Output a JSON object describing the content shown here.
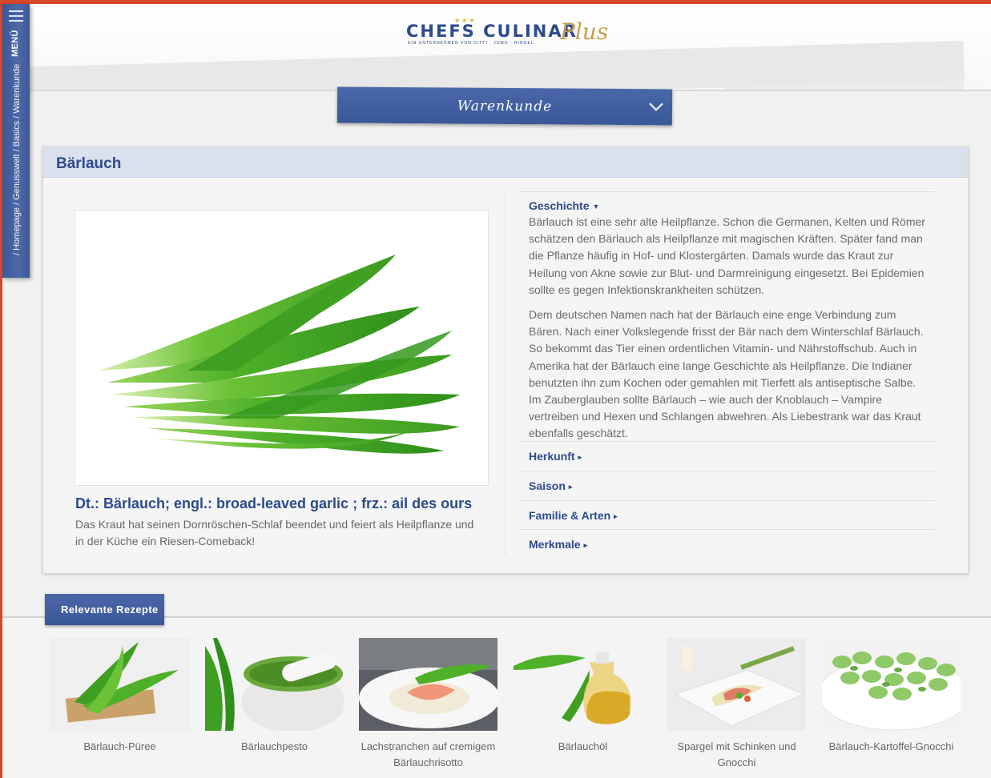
{
  "brand": {
    "name": "CHEFS CULINAR",
    "tagline": "EIN UNTERNEHMEN VON DITTI · JOMO · RINGEL",
    "plus": "Plus"
  },
  "side_menu": {
    "menu_label": "MENÜ",
    "breadcrumb": "/ Homepage / Genusswelt / Basics / Warenkunde"
  },
  "category_select": {
    "label": "Warenkunde"
  },
  "product": {
    "title": "Bärlauch",
    "names": "Dt.: Bärlauch; engl.: broad-leaved garlic ; frz.: ail des ours",
    "intro": "Das Kraut hat seinen Dornröschen-Schlaf beendet und feiert als Heilpflanze und in der Küche ein Riesen-Comeback!"
  },
  "accordion": {
    "open": {
      "title": "Geschichte",
      "paragraphs": [
        "Bärlauch ist eine sehr alte Heilpflanze. Schon die Germanen, Kelten und Römer schätzen den Bärlauch als Heilpflanze mit magischen Kräften. Später fand man die Pflanze häufig in Hof- und Klostergärten. Damals wurde das Kraut zur Heilung von Akne sowie zur Blut- und Darmreinigung eingesetzt. Bei Epidemien sollte es gegen Infektionskrankheiten schützen.",
        "Dem deutschen Namen nach hat der Bärlauch eine enge Verbindung zum Bären. Nach einer Volkslegende frisst der Bär nach dem Winterschlaf Bärlauch. So bekommt das Tier einen ordentlichen Vitamin- und Nährstoffschub. Auch in Amerika hat der Bärlauch eine lange Geschichte als Heilpflanze. Die Indianer benutzten ihn zum Kochen oder gemahlen mit Tierfett als antiseptische Salbe. Im Zauberglauben sollte Bärlauch – wie auch der Knoblauch – Vampire vertreiben und Hexen und Schlangen abwehren. Als Liebestrank war das Kraut ebenfalls geschätzt."
      ]
    },
    "closed": [
      "Herkunft",
      "Saison",
      "Familie & Arten",
      "Merkmale"
    ]
  },
  "recipes": {
    "heading": "Relevante Rezepte",
    "items": [
      {
        "label": "Bärlauch-Püree"
      },
      {
        "label": "Bärlauchpesto"
      },
      {
        "label": "Lachstranchen auf cremigem Bärlauchrisotto"
      },
      {
        "label": "Bärlauchöl"
      },
      {
        "label": "Spargel mit Schinken und Gnocchi"
      },
      {
        "label": "Bärlauch-Kartoffel-Gnocchi"
      }
    ]
  },
  "colors": {
    "accent_blue": "#3f5c9c",
    "frame_orange": "#d9472a",
    "leaf_green": "#4caf2a"
  }
}
